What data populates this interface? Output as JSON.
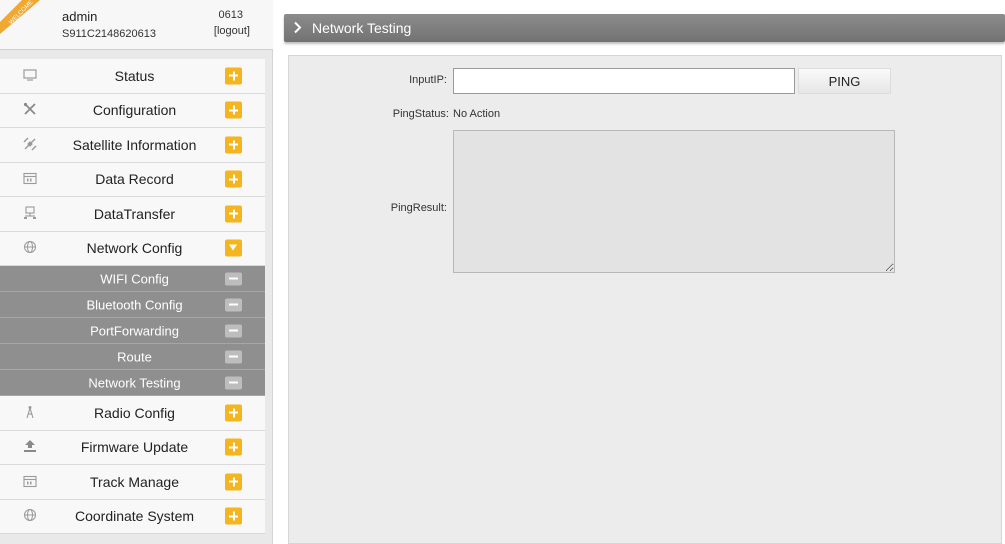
{
  "user": {
    "name": "admin",
    "serial": "S911C2148620613",
    "code": "0613",
    "logout": "[logout]"
  },
  "sidebar": {
    "menu": [
      {
        "label": "Status",
        "icon": "monitor-icon",
        "toggle": "plus"
      },
      {
        "label": "Configuration",
        "icon": "tools-icon",
        "toggle": "plus"
      },
      {
        "label": "Satellite Information",
        "icon": "satellite-icon",
        "toggle": "plus"
      },
      {
        "label": "Data Record",
        "icon": "calendar-icon",
        "toggle": "plus"
      },
      {
        "label": "DataTransfer",
        "icon": "network-icon",
        "toggle": "plus"
      },
      {
        "label": "Network Config",
        "icon": "globe-icon",
        "toggle": "expanded"
      }
    ],
    "submenu": [
      {
        "label": "WIFI Config"
      },
      {
        "label": "Bluetooth Config"
      },
      {
        "label": "PortForwarding"
      },
      {
        "label": "Route"
      },
      {
        "label": "Network Testing"
      }
    ],
    "menu_after": [
      {
        "label": "Radio Config",
        "icon": "antenna-icon",
        "toggle": "plus"
      },
      {
        "label": "Firmware Update",
        "icon": "upload-icon",
        "toggle": "plus"
      },
      {
        "label": "Track Manage",
        "icon": "calendar-icon",
        "toggle": "plus"
      },
      {
        "label": "Coordinate System",
        "icon": "globe-icon",
        "toggle": "plus"
      }
    ]
  },
  "main": {
    "title": "Network Testing",
    "form": {
      "input_ip_label": "InputIP:",
      "input_ip_value": "",
      "ping_button": "PING",
      "ping_status_label": "PingStatus:",
      "ping_status_value": "No Action",
      "ping_result_label": "PingResult:",
      "ping_result_value": ""
    }
  },
  "colors": {
    "accent_toggle": "#f5b51e",
    "submenu_bg": "#8f8f8f",
    "title_bar": "#7f7f7f",
    "welcome_ribbon": "#f0a830"
  }
}
